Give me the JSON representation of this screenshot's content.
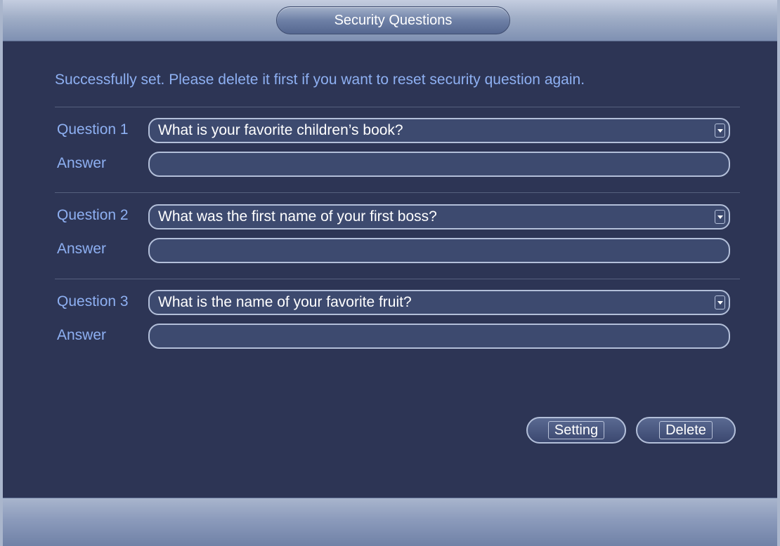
{
  "dialog": {
    "title": "Security Questions",
    "notice": "Successfully set. Please delete it first if you want to reset security question again."
  },
  "questions": [
    {
      "label": "Question 1",
      "selected": "What is your favorite children’s book?",
      "answer_label": "Answer",
      "answer_value": ""
    },
    {
      "label": "Question 2",
      "selected": "What was the first name of your first boss?",
      "answer_label": "Answer",
      "answer_value": ""
    },
    {
      "label": "Question 3",
      "selected": "What is the name of your favorite fruit?",
      "answer_label": "Answer",
      "answer_value": ""
    }
  ],
  "buttons": {
    "setting": "Setting",
    "delete": "Delete"
  },
  "icons": {
    "dropdown": "chevron-down-icon"
  },
  "colors": {
    "background": "#2d3555",
    "label_text": "#8eb0f2",
    "field_border": "#b3bfd9"
  }
}
